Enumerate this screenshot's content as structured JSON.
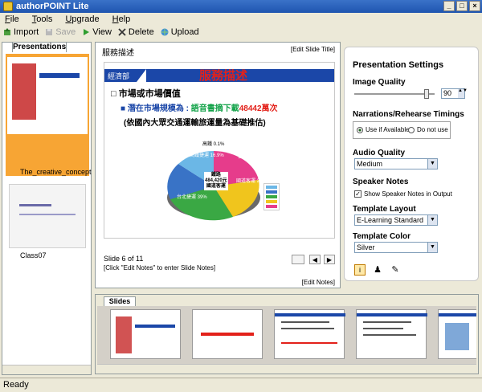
{
  "app": {
    "title": "authorPOINT Lite"
  },
  "menu": [
    "File",
    "Tools",
    "Upgrade",
    "Help"
  ],
  "toolbar": {
    "import": "Import",
    "save": "Save",
    "view": "View",
    "delete": "Delete",
    "upload": "Upload"
  },
  "left": {
    "tab": "Presentations",
    "items": [
      {
        "label": "The_creative_concept",
        "selected": true
      },
      {
        "label": "Class07",
        "selected": false
      }
    ]
  },
  "center": {
    "slide_title_link": "[Edit Slide Title]",
    "slide_title": "服務描述",
    "slide": {
      "brand": "經濟部",
      "heading": "服務描述",
      "bullet1": "市場或市場價值",
      "bullet2_prefix": "潛在市場規模為 : ",
      "bullet2_highlight": "語音書摘下載",
      "bullet2_value": "48442萬次",
      "bullet3": "(依國內大眾交通運輸旅運量為基礎推估)",
      "pie_labels": [
        "高鐵 0.1%",
        "高鐵捷運 16.9%",
        "台鐵 16%",
        "國道客運 26%",
        "台北捷運 39%"
      ],
      "center_label": [
        "鐵路",
        "484,420元",
        "國道客運"
      ]
    },
    "slide_counter": "Slide 6 of 11",
    "notes_hint": "[Click \"Edit Notes\" to enter Slide Notes]",
    "edit_notes": "[Edit Notes]"
  },
  "settings": {
    "heading": "Presentation Settings",
    "image_quality_label": "Image Quality",
    "image_quality_value": "90",
    "image_quality_level": 0.9,
    "timings_label": "Narrations/Rehearse Timings",
    "timings_options": [
      "Use if Available",
      "Do not use"
    ],
    "timings_selected": 0,
    "audio_label": "Audio Quality",
    "audio_value": "Medium",
    "speaker_label": "Speaker Notes",
    "speaker_checkbox": "Show Speaker Notes in Output",
    "speaker_checked": true,
    "layout_label": "Template Layout",
    "layout_value": "E-Learning Standard",
    "color_label": "Template Color",
    "color_value": "Silver"
  },
  "bottom": {
    "tab": "Slides"
  },
  "status": "Ready",
  "colors": {
    "accent": "#f7a534",
    "brand_blue": "#1b47a8",
    "slide_red": "#e3211a"
  }
}
